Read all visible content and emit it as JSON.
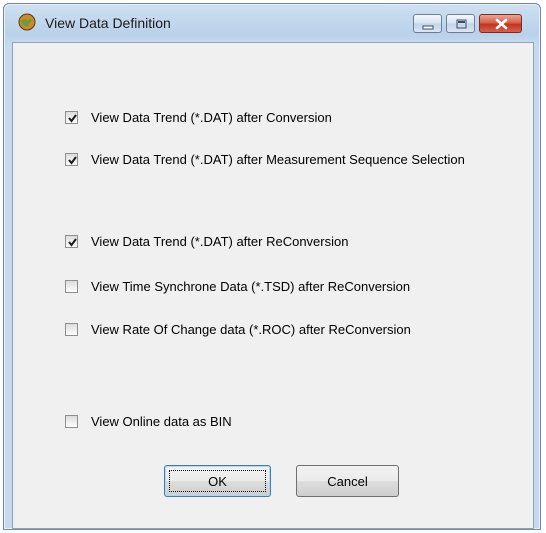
{
  "window": {
    "title": "View Data Definition",
    "icons": {
      "app": "globe-icon",
      "minimize": "minimize-icon",
      "maximize": "maximize-icon",
      "close": "close-icon"
    }
  },
  "options": [
    {
      "label": "View Data Trend  (*.DAT) after Conversion",
      "checked": true
    },
    {
      "label": "View Data Trend  (*.DAT) after Measurement Sequence Selection",
      "checked": true
    },
    {
      "label": "View Data Trend  (*.DAT) after ReConversion",
      "checked": true
    },
    {
      "label": "View Time Synchrone Data  (*.TSD) after ReConversion",
      "checked": false
    },
    {
      "label": "View Rate Of Change data  (*.ROC) after ReConversion",
      "checked": false
    },
    {
      "label": "View Online data as BIN",
      "checked": false
    }
  ],
  "buttons": {
    "ok": "OK",
    "cancel": "Cancel"
  }
}
